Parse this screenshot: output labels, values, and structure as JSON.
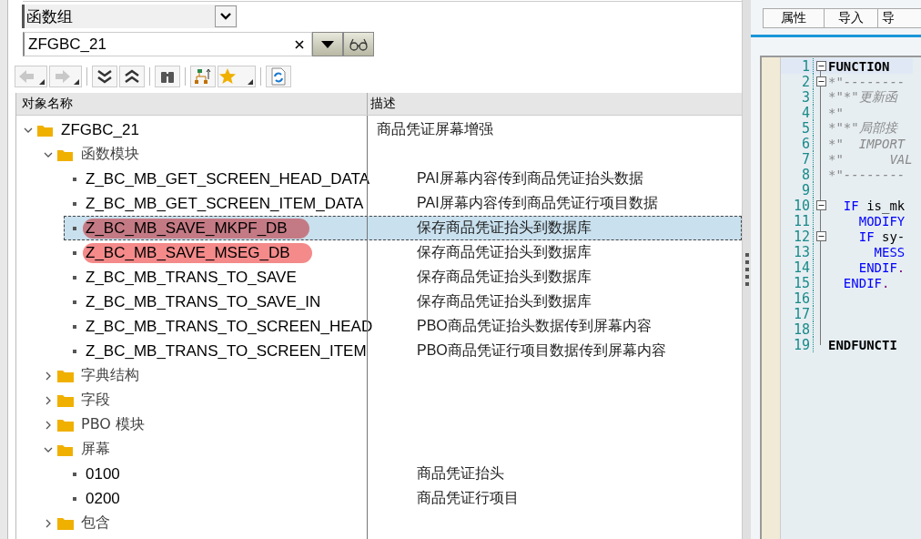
{
  "search": {
    "object_type": "函数组",
    "value": "ZFGBC_21"
  },
  "tree": {
    "columns": [
      "对象名称",
      "描述"
    ],
    "items": [
      {
        "name": "ZFGBC_21",
        "description": "商品凭证屏幕增强",
        "kind": "folder",
        "expanded": true,
        "selected": false,
        "marked": false,
        "children": [
          {
            "name": "函数模块",
            "kind": "folder",
            "expanded": true,
            "selected": false,
            "marked": false,
            "children": [
              {
                "name": "Z_BC_MB_GET_SCREEN_HEAD_DATA",
                "description": "PAI屏幕内容传到商品凭证抬头数据",
                "kind": "leaf",
                "selected": false,
                "marked": false
              },
              {
                "name": "Z_BC_MB_GET_SCREEN_ITEM_DATA",
                "description": "PAI屏幕内容传到商品凭证行项目数据",
                "kind": "leaf",
                "selected": false,
                "marked": false
              },
              {
                "name": "Z_BC_MB_SAVE_MKPF_DB",
                "description": "保存商品凭证抬头到数据库",
                "kind": "leaf",
                "selected": true,
                "marked": true
              },
              {
                "name": "Z_BC_MB_SAVE_MSEG_DB",
                "description": "保存商品凭证抬头到数据库",
                "kind": "leaf",
                "selected": false,
                "marked": true
              },
              {
                "name": "Z_BC_MB_TRANS_TO_SAVE",
                "description": "保存商品凭证抬头到数据库",
                "kind": "leaf",
                "selected": false,
                "marked": false
              },
              {
                "name": "Z_BC_MB_TRANS_TO_SAVE_IN",
                "description": "保存商品凭证抬头到数据库",
                "kind": "leaf",
                "selected": false,
                "marked": false
              },
              {
                "name": "Z_BC_MB_TRANS_TO_SCREEN_HEAD",
                "description": "PBO商品凭证抬头数据传到屏幕内容",
                "kind": "leaf",
                "selected": false,
                "marked": false
              },
              {
                "name": "Z_BC_MB_TRANS_TO_SCREEN_ITEM",
                "description": "PBO商品凭证行项目数据传到屏幕内容",
                "kind": "leaf",
                "selected": false,
                "marked": false
              }
            ]
          },
          {
            "name": "字典结构",
            "kind": "folder",
            "expanded": false,
            "selected": false,
            "marked": false
          },
          {
            "name": "字段",
            "kind": "folder",
            "expanded": false,
            "selected": false,
            "marked": false
          },
          {
            "name": "PBO 模块",
            "kind": "folder",
            "expanded": false,
            "selected": false,
            "marked": false
          },
          {
            "name": "屏幕",
            "kind": "folder",
            "expanded": true,
            "selected": false,
            "marked": false,
            "children": [
              {
                "name": "0100",
                "description": "商品凭证抬头",
                "kind": "leaf",
                "selected": false,
                "marked": false
              },
              {
                "name": "0200",
                "description": "商品凭证行项目",
                "kind": "leaf",
                "selected": false,
                "marked": false
              }
            ]
          },
          {
            "name": "包含",
            "kind": "folder",
            "expanded": false,
            "selected": false,
            "marked": false
          }
        ]
      }
    ]
  },
  "editor_tabs": [
    {
      "label": "属性",
      "selected": false
    },
    {
      "label": "导入",
      "selected": false
    },
    {
      "label": "导",
      "selected": false
    }
  ],
  "code": [
    {
      "num": "1",
      "fold": true,
      "parts": [
        {
          "text": "FUNCTION",
          "kind": "bold"
        }
      ]
    },
    {
      "num": "2",
      "fold": true,
      "parts": [
        {
          "text": "*\"--------",
          "kind": "comment"
        }
      ]
    },
    {
      "num": "3",
      "fold": false,
      "parts": [
        {
          "text": "*\"*\"更新函",
          "kind": "comment"
        }
      ]
    },
    {
      "num": "4",
      "fold": false,
      "parts": [
        {
          "text": "*\"",
          "kind": "comment"
        }
      ]
    },
    {
      "num": "5",
      "fold": false,
      "parts": [
        {
          "text": "*\"*\"局部接",
          "kind": "comment"
        }
      ]
    },
    {
      "num": "6",
      "fold": false,
      "parts": [
        {
          "text": "*\"  IMPORT",
          "kind": "comment"
        }
      ]
    },
    {
      "num": "7",
      "fold": false,
      "parts": [
        {
          "text": "*\"      VAL",
          "kind": "comment"
        }
      ]
    },
    {
      "num": "8",
      "fold": false,
      "parts": [
        {
          "text": "*\"--------",
          "kind": "comment"
        }
      ]
    },
    {
      "num": "9",
      "fold": false
    },
    {
      "num": "10",
      "fold": true,
      "parts": [
        {
          "text": "  IF",
          "kind": "keyword"
        },
        {
          "text": " is_mk",
          "kind": "plain"
        }
      ]
    },
    {
      "num": "11",
      "fold": false,
      "parts": [
        {
          "text": "    MODIFY",
          "kind": "keyword"
        }
      ]
    },
    {
      "num": "12",
      "fold": true,
      "parts": [
        {
          "text": "    IF",
          "kind": "keyword"
        },
        {
          "text": " sy-",
          "kind": "plain"
        }
      ]
    },
    {
      "num": "13",
      "fold": false,
      "parts": [
        {
          "text": "      MESS",
          "kind": "keyword"
        }
      ]
    },
    {
      "num": "14",
      "fold": false,
      "parts": [
        {
          "text": "    ENDIF",
          "kind": "keyword"
        },
        {
          "text": ".",
          "kind": "punct"
        }
      ]
    },
    {
      "num": "15",
      "fold": false,
      "parts": [
        {
          "text": "  ENDIF",
          "kind": "keyword"
        },
        {
          "text": ".",
          "kind": "punct"
        }
      ]
    },
    {
      "num": "16",
      "fold": false
    },
    {
      "num": "17",
      "fold": false
    },
    {
      "num": "18",
      "fold": false
    },
    {
      "num": "19",
      "fold": false,
      "parts": [
        {
          "text": "ENDFUNCTI",
          "kind": "bold"
        }
      ]
    }
  ]
}
